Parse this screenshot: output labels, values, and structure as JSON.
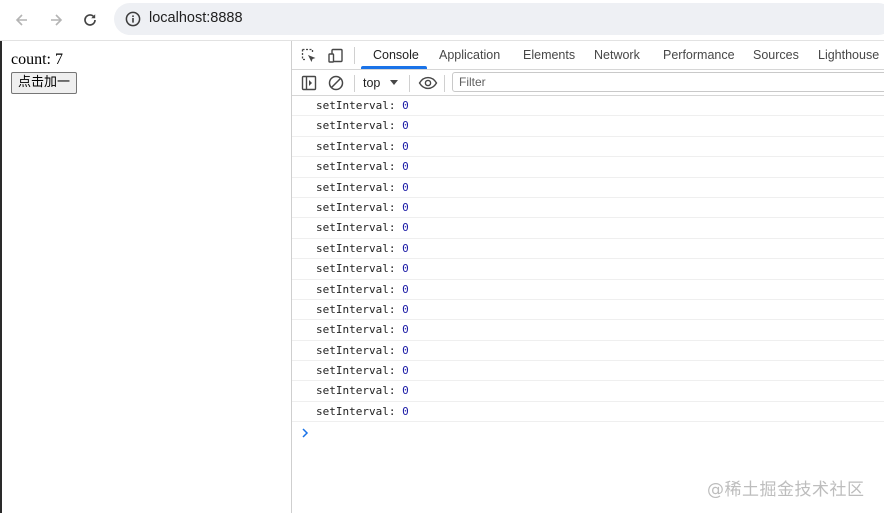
{
  "browser": {
    "url": "localhost:8888",
    "icons": {
      "back": "back-arrow-icon",
      "forward": "forward-arrow-icon",
      "reload": "reload-icon",
      "site_info": "info-icon"
    }
  },
  "page": {
    "count_label": "count: 7",
    "add_button_label": "点击加一"
  },
  "devtools": {
    "tabs": [
      {
        "label": "Console",
        "active": true
      },
      {
        "label": "Application",
        "active": false
      },
      {
        "label": "Elements",
        "active": false
      },
      {
        "label": "Network",
        "active": false
      },
      {
        "label": "Performance",
        "active": false
      },
      {
        "label": "Sources",
        "active": false
      },
      {
        "label": "Lighthouse",
        "active": false
      }
    ],
    "context": "top",
    "filter_placeholder": "Filter",
    "accent_color": "#1a73e8",
    "logs": [
      {
        "text": "setInterval: ",
        "value": "0"
      },
      {
        "text": "setInterval: ",
        "value": "0"
      },
      {
        "text": "setInterval: ",
        "value": "0"
      },
      {
        "text": "setInterval: ",
        "value": "0"
      },
      {
        "text": "setInterval: ",
        "value": "0"
      },
      {
        "text": "setInterval: ",
        "value": "0"
      },
      {
        "text": "setInterval: ",
        "value": "0"
      },
      {
        "text": "setInterval: ",
        "value": "0"
      },
      {
        "text": "setInterval: ",
        "value": "0"
      },
      {
        "text": "setInterval: ",
        "value": "0"
      },
      {
        "text": "setInterval: ",
        "value": "0"
      },
      {
        "text": "setInterval: ",
        "value": "0"
      },
      {
        "text": "setInterval: ",
        "value": "0"
      },
      {
        "text": "setInterval: ",
        "value": "0"
      },
      {
        "text": "setInterval: ",
        "value": "0"
      },
      {
        "text": "setInterval: ",
        "value": "0"
      }
    ]
  },
  "watermark": "@稀土掘金技术社区"
}
